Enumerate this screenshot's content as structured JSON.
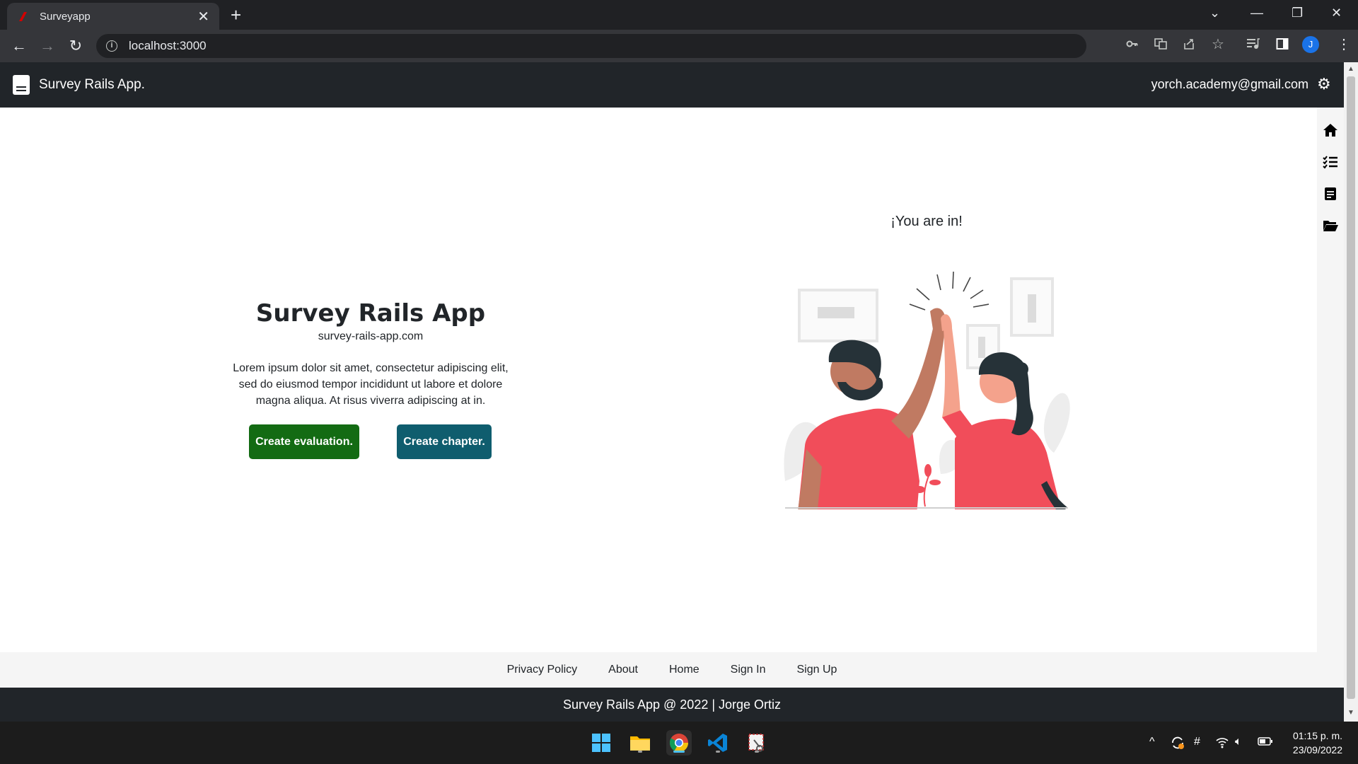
{
  "browser": {
    "tab_title": "Surveyapp",
    "tab_close": "✕",
    "new_tab": "+",
    "url": "localhost:3000",
    "profile_initial": "J",
    "accent": "#1a73e8"
  },
  "navbar": {
    "brand": "Survey Rails App.",
    "user_email": "yorch.academy@gmail.com"
  },
  "sidebar": {
    "items": [
      "home-icon",
      "checklist-icon",
      "document-icon",
      "folder-icon"
    ]
  },
  "hero": {
    "title": "Survey Rails App",
    "site": "survey-rails-app.com",
    "text": "Lorem ipsum dolor sit amet, consectetur adipiscing elit, sed do eiusmod tempor incididunt ut labore et dolore magna aliqua. At risus viverra adipiscing at in.",
    "button_evaluation": "Create evaluation.",
    "button_chapter": "Create chapter.",
    "colors": {
      "evaluation": "#136b13",
      "chapter": "#0f5d6e"
    }
  },
  "welcome": {
    "text": "¡You are in!"
  },
  "footer": {
    "links": [
      "Privacy Policy",
      "About",
      "Home",
      "Sign In",
      "Sign Up"
    ],
    "copyright": "Survey Rails App @ 2022 | Jorge Ortiz"
  },
  "taskbar": {
    "time": "01:15 p. m.",
    "date": "23/09/2022"
  }
}
